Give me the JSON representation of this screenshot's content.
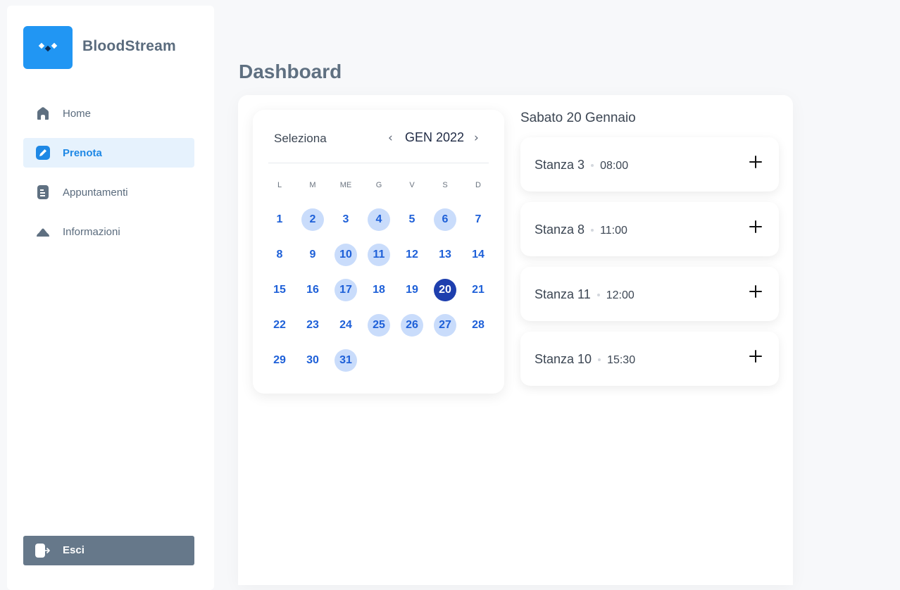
{
  "app": {
    "name": "BloodStream"
  },
  "sidebar": {
    "items": [
      {
        "label": "Home",
        "icon": "home-icon",
        "active": false
      },
      {
        "label": "Prenota",
        "icon": "pencil-icon",
        "active": true
      },
      {
        "label": "Appuntamenti",
        "icon": "document-icon",
        "active": false
      },
      {
        "label": "Informazioni",
        "icon": "cloud-icon",
        "active": false
      }
    ],
    "logout_label": "Esci"
  },
  "page": {
    "title": "Dashboard"
  },
  "calendar": {
    "title": "Seleziona",
    "month_label": "GEN 2022",
    "prev_icon": "chevron-left-icon",
    "next_icon": "chevron-right-icon",
    "weekdays": [
      "L",
      "M",
      "ME",
      "G",
      "V",
      "S",
      "D"
    ],
    "first_weekday_index": 0,
    "days_in_month": 31,
    "marked_days": [
      2,
      4,
      6,
      10,
      11,
      17,
      25,
      26,
      27,
      31
    ],
    "selected_day": 20
  },
  "slots": {
    "date_label": "Sabato 20 Gennaio",
    "items": [
      {
        "room": "Stanza 3",
        "time": "08:00"
      },
      {
        "room": "Stanza 8",
        "time": "11:00"
      },
      {
        "room": "Stanza 11",
        "time": "12:00"
      },
      {
        "room": "Stanza 10",
        "time": "15:30"
      }
    ]
  },
  "colors": {
    "accent": "#2196f3",
    "active_nav_bg": "#e6f2fd",
    "day_text": "#1e60d8",
    "marked_day_bg": "#c9dcfb",
    "selected_day_bg": "#1e3fae",
    "logout_bg": "#66788a"
  }
}
